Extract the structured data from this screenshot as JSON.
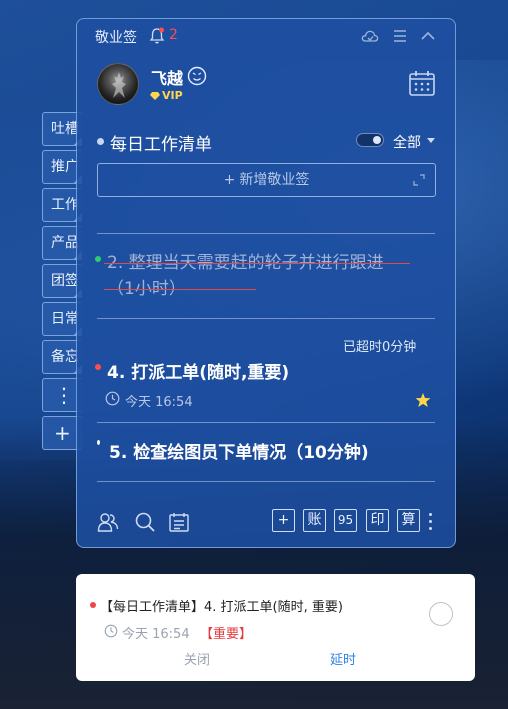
{
  "side_tabs": [
    "吐槽",
    "推广",
    "工作",
    "产品",
    "团签",
    "日常",
    "备忘"
  ],
  "side_tab_more": "⋮",
  "side_tab_add": "+",
  "app": {
    "name": "敬业签",
    "notification_count": "2"
  },
  "user": {
    "name": "飞越",
    "badge": "VIP"
  },
  "list": {
    "title": "每日工作清单",
    "filter": "全部",
    "add_placeholder": "新增敬业签"
  },
  "tasks": [
    {
      "text_line1": "2. 整理当天需要赶的轮子并进行跟进",
      "text_line2": "（1小时）",
      "status": "completed",
      "dot_color": "#2ecc71"
    },
    {
      "overdue": "已超时0分钟",
      "text": "4. 打派工单(随时,重要)",
      "time": "今天 16:54",
      "dot_color": "#ff4d4d",
      "starred": true
    },
    {
      "text": "5. 检查绘图员下单情况（10分钟)",
      "dot_color": "#ffffff"
    }
  ],
  "toolbar": {
    "box_labels": [
      "+",
      "账",
      "95",
      "印",
      "算"
    ]
  },
  "popup": {
    "title": "【每日工作清单】4. 打派工单(随时, 重要)",
    "time": "今天 16:54",
    "tag": "【重要】",
    "close_label": "关闭",
    "delay_label": "延时"
  },
  "colors": {
    "panel_bg": "#1e4ea0",
    "accent_red": "#ff4d4d",
    "accent_green": "#2ecc71",
    "link_blue": "#2f7fe6"
  }
}
